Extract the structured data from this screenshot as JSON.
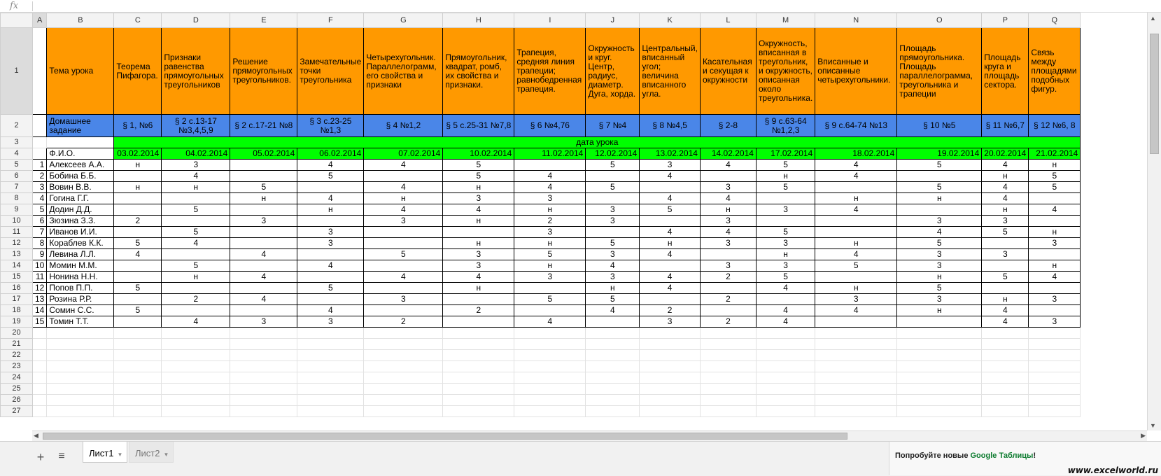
{
  "formula_bar": {
    "label": "fx",
    "value": ""
  },
  "columns": [
    "A",
    "B",
    "C",
    "D",
    "E",
    "F",
    "G",
    "H",
    "I",
    "J",
    "K",
    "L",
    "M",
    "N",
    "O",
    "P",
    "Q"
  ],
  "selected_cell": "A1",
  "rows": {
    "r1": [
      "",
      "Тема урока",
      "Теорема Пифагора.",
      "Признаки равенства прямоугольных треугольников",
      "Решение прямоугольных треугольников.",
      "Замечательные точки треугольника",
      "Четырехугольник. Параллелограмм, его свойства и признаки",
      "Прямоугольник, квадрат, ромб, их свойства и признаки.",
      "Трапеция, средняя линия трапеции; равнобедренная трапеция.",
      "Окружность и круг. Центр, радиус, диаметр. Дуга, хорда.",
      "Центральный, вписанный угол; величина вписанного угла.",
      "Касательная и секущая к окружности",
      "Окружность, вписанная в треугольник, и окружность, описанная около треугольника.",
      "Вписанные и описанные четырехугольники.",
      "Площадь прямоугольника. Площадь параллелограмма, треугольника и трапеции",
      "Площадь круга и площадь сектора.",
      "Связь между площадями подобных фигур."
    ],
    "r2": [
      "",
      "Домашнее задание",
      "§ 1, №6",
      "§ 2 с.13-17 №3,4,5,9",
      "§ 2 с.17-21 №8",
      "§ 3 с.23-25 №1,3",
      "§ 4 №1,2",
      "§ 5 с.25-31 №7,8",
      "§ 6 №4,76",
      "§ 7 №4",
      "§ 8 №4,5",
      "§ 2-8",
      "§ 9 с.63-64 №1,2,3",
      "§ 9 с.64-74 №13",
      "§ 10 №5",
      "§ 11 №6,7",
      "§ 12 №6, 8"
    ],
    "r3_label": "дата урока",
    "r4": [
      "",
      "Ф.И.О.",
      "03.02.2014",
      "04.02.2014",
      "05.02.2014",
      "06.02.2014",
      "07.02.2014",
      "10.02.2014",
      "11.02.2014",
      "12.02.2014",
      "13.02.2014",
      "14.02.2014",
      "17.02.2014",
      "18.02.2014",
      "19.02.2014",
      "20.02.2014",
      "21.02.2014"
    ],
    "students": [
      [
        "1",
        "Алексеев А.А.",
        "н",
        "3",
        "",
        "4",
        "4",
        "5",
        "",
        "5",
        "3",
        "4",
        "5",
        "4",
        "5",
        "4",
        "н"
      ],
      [
        "2",
        "Бобина Б.Б.",
        "",
        "4",
        "",
        "5",
        "",
        "5",
        "4",
        "",
        "4",
        "",
        "н",
        "4",
        "",
        "н",
        "5"
      ],
      [
        "3",
        "Вовин В.В.",
        "н",
        "н",
        "5",
        "",
        "4",
        "н",
        "4",
        "5",
        "",
        "3",
        "5",
        "",
        "5",
        "4",
        "5"
      ],
      [
        "4",
        "Гогина Г.Г.",
        "",
        "",
        "н",
        "4",
        "н",
        "3",
        "3",
        "",
        "4",
        "4",
        "",
        "н",
        "н",
        "4",
        ""
      ],
      [
        "5",
        "Додин Д.Д.",
        "",
        "5",
        "",
        "н",
        "4",
        "4",
        "н",
        "3",
        "5",
        "н",
        "3",
        "4",
        "",
        "н",
        "4"
      ],
      [
        "6",
        "Зюзина З.З.",
        "2",
        "",
        "3",
        "",
        "3",
        "н",
        "2",
        "3",
        "",
        "3",
        "",
        "",
        "3",
        "3",
        ""
      ],
      [
        "7",
        "Иванов И.И.",
        "",
        "5",
        "",
        "3",
        "",
        "",
        "3",
        "",
        "4",
        "4",
        "5",
        "",
        "4",
        "5",
        "н"
      ],
      [
        "8",
        "Кораблев К.К.",
        "5",
        "4",
        "",
        "3",
        "",
        "н",
        "н",
        "5",
        "н",
        "3",
        "3",
        "н",
        "5",
        "",
        "3"
      ],
      [
        "9",
        "Левина Л.Л.",
        "4",
        "",
        "4",
        "",
        "5",
        "3",
        "5",
        "3",
        "4",
        "",
        "н",
        "4",
        "3",
        "3",
        ""
      ],
      [
        "10",
        "Момин М.М.",
        "",
        "5",
        "",
        "4",
        "",
        "3",
        "н",
        "4",
        "",
        "3",
        "3",
        "5",
        "3",
        "",
        "н"
      ],
      [
        "11",
        "Нонина Н.Н.",
        "",
        "н",
        "4",
        "",
        "4",
        "4",
        "3",
        "3",
        "4",
        "2",
        "5",
        "",
        "н",
        "5",
        "4"
      ],
      [
        "12",
        "Попов П.П.",
        "5",
        "",
        "",
        "5",
        "",
        "н",
        "",
        "н",
        "4",
        "",
        "4",
        "н",
        "5",
        "",
        ""
      ],
      [
        "13",
        "Розина Р.Р.",
        "",
        "2",
        "4",
        "",
        "3",
        "",
        "5",
        "5",
        "",
        "2",
        "",
        "3",
        "3",
        "н",
        "3"
      ],
      [
        "14",
        "Сомин С.С.",
        "5",
        "",
        "",
        "4",
        "",
        "2",
        "",
        "4",
        "2",
        "",
        "4",
        "4",
        "н",
        "4",
        ""
      ],
      [
        "15",
        "Томин Т.Т.",
        "",
        "4",
        "3",
        "3",
        "2",
        "",
        "4",
        "",
        "3",
        "2",
        "4",
        "",
        "",
        "4",
        "3"
      ]
    ],
    "empty_row_numbers": [
      "20",
      "21",
      "22",
      "23",
      "24",
      "25",
      "26",
      "27"
    ]
  },
  "sheet_tabs": {
    "add_label": "+",
    "list_label": "≡",
    "tabs": [
      "Лист1",
      "Лист2"
    ],
    "active": "Лист1"
  },
  "promo": {
    "text_prefix": "Попробуйте новые ",
    "link": "Google Таблицы",
    "suffix": "!"
  },
  "watermark": "www.excelworld.ru",
  "colors": {
    "header_orange": "#ff9900",
    "homework_blue": "#4a86e8",
    "date_green": "#00ff00"
  }
}
